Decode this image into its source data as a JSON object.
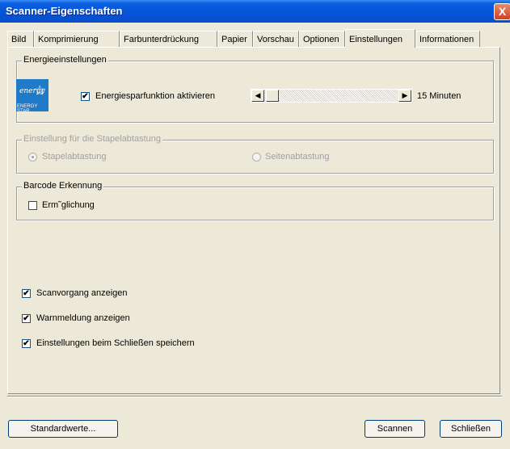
{
  "window": {
    "title": "Scanner-Eigenschaften",
    "close_glyph": "X"
  },
  "tabs": [
    "Bild",
    "Komprimierung",
    "Farbunterdrückung",
    "Papier",
    "Vorschau",
    "Optionen",
    "Einstellungen",
    "Informationen"
  ],
  "active_tab": "Einstellungen",
  "energy": {
    "legend": "Energieeinstellungen",
    "logo_word": "energy",
    "logo_label": "ENERGY STAR",
    "checkbox_label": "Energiesparfunktion aktivieren",
    "checked": true,
    "minutes_label": "15 Minuten"
  },
  "batch": {
    "legend": "Einstellung für die Stapelabtastung",
    "option1": "Stapelabtastung",
    "option2": "Seitenabtastung",
    "selected": "Stapelabtastung"
  },
  "barcode": {
    "legend": "Barcode Erkennung",
    "checkbox_label": "Erm˜glichung",
    "checked": false
  },
  "options": {
    "scan_progress": "Scanvorgang anzeigen",
    "warning": "Warnmeldung anzeigen",
    "save_on_close": "Einstellungen beim Schließen speichern"
  },
  "buttons": {
    "defaults": "Standardwerte...",
    "scan": "Scannen",
    "close": "Schließen"
  },
  "checkmark": "✔",
  "arrows": {
    "left": "◀",
    "right": "▶"
  }
}
